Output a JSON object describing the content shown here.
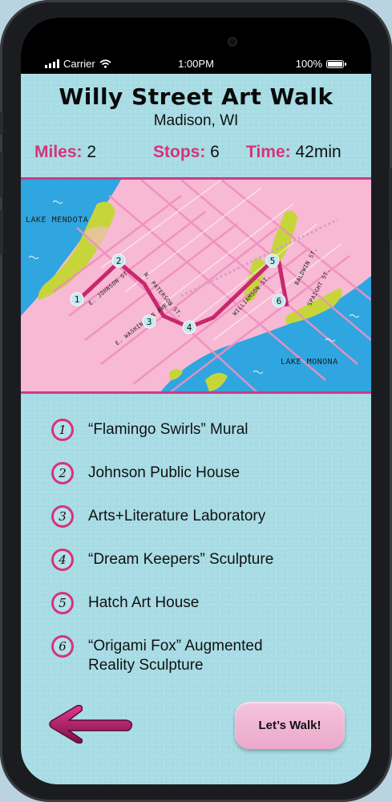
{
  "status_bar": {
    "carrier": "Carrier",
    "time": "1:00PM",
    "battery": "100%"
  },
  "header": {
    "title": "Willy Street Art Walk",
    "location": "Madison, WI"
  },
  "stats": [
    {
      "label": "Miles:",
      "value": "2"
    },
    {
      "label": "Stops:",
      "value": "6"
    },
    {
      "label": "Time:",
      "value": "42min"
    }
  ],
  "map": {
    "lake_labels": [
      "LAKE MENDOTA",
      "LAKE MONONA"
    ],
    "street_labels": [
      "E. JOHNSON ST.",
      "N. PATERSON ST.",
      "E. WASHINGTON AVE.",
      "WILLIAMSON ST.",
      "BALDWIN ST.",
      "SPAIGHT ST."
    ],
    "markers": [
      "1",
      "2",
      "3",
      "4",
      "5",
      "6"
    ],
    "colors": {
      "land": "#f7b9d3",
      "water": "#2fa6e0",
      "route": "#c7286e",
      "park": "#c6d63a"
    }
  },
  "stops": [
    {
      "number": "1",
      "name": "“Flamingo Swirls” Mural"
    },
    {
      "number": "2",
      "name": "Johnson Public House"
    },
    {
      "number": "3",
      "name": " Arts+Literature Laboratory"
    },
    {
      "number": "4",
      "name": "“Dream Keepers” Sculpture"
    },
    {
      "number": "5",
      "name": "Hatch Art House"
    },
    {
      "number": "6",
      "name": "“Origami Fox” Augmented Reality Sculpture"
    }
  ],
  "actions": {
    "back_icon": "left-arrow-icon",
    "walk_label": "Let’s Walk!"
  },
  "colors": {
    "accent": "#d6337a",
    "background": "#a9dde6"
  }
}
